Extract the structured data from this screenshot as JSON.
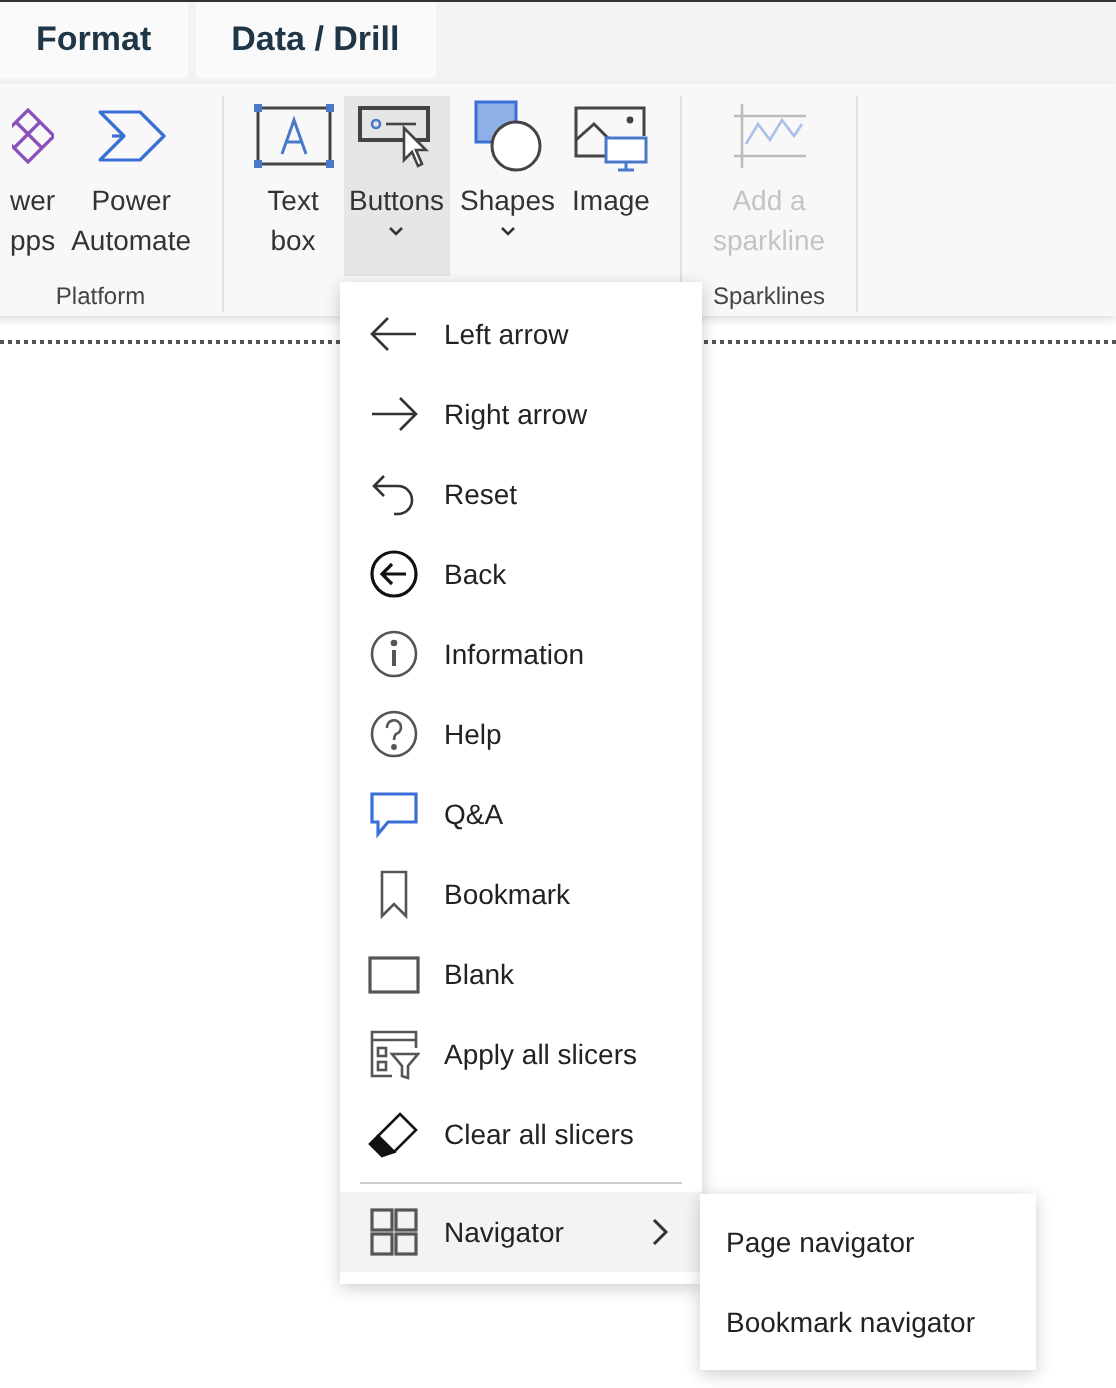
{
  "tabs": [
    {
      "label": "Format",
      "selected": false
    },
    {
      "label": "Data / Drill",
      "selected": false
    }
  ],
  "ribbon": {
    "groups": [
      {
        "label": "Platform",
        "items": [
          {
            "kind": "powerapps",
            "label_lines": [
              "wer",
              "pps"
            ],
            "selected": false,
            "disabled": false,
            "dropdown": false
          },
          {
            "kind": "automate",
            "label_lines": [
              "Power",
              "Automate"
            ],
            "selected": false,
            "disabled": false,
            "dropdown": false
          }
        ]
      },
      {
        "items": [
          {
            "kind": "textbox",
            "label_lines": [
              "Text",
              "box"
            ],
            "selected": false,
            "disabled": false,
            "dropdown": false
          },
          {
            "kind": "buttons",
            "label_lines": [
              "Buttons"
            ],
            "selected": true,
            "disabled": false,
            "dropdown": true
          },
          {
            "kind": "shapes",
            "label_lines": [
              "Shapes"
            ],
            "selected": false,
            "disabled": false,
            "dropdown": true
          },
          {
            "kind": "image",
            "label_lines": [
              "Image"
            ],
            "selected": false,
            "disabled": false,
            "dropdown": false
          }
        ]
      },
      {
        "label": "Sparklines",
        "items": [
          {
            "kind": "sparkline",
            "label_lines": [
              "Add a",
              "sparkline"
            ],
            "selected": false,
            "disabled": true,
            "dropdown": false
          }
        ]
      }
    ]
  },
  "menu": {
    "items": [
      {
        "kind": "left",
        "label": "Left arrow"
      },
      {
        "kind": "right",
        "label": "Right arrow"
      },
      {
        "kind": "reset",
        "label": "Reset"
      },
      {
        "kind": "back",
        "label": "Back"
      },
      {
        "kind": "info",
        "label": "Information"
      },
      {
        "kind": "help",
        "label": "Help"
      },
      {
        "kind": "qa",
        "label": "Q&A"
      },
      {
        "kind": "bookmark",
        "label": "Bookmark"
      },
      {
        "kind": "blank",
        "label": "Blank"
      },
      {
        "kind": "apply",
        "label": "Apply all slicers"
      },
      {
        "kind": "clear",
        "label": "Clear all slicers"
      },
      {
        "kind": "navigator",
        "label": "Navigator",
        "expanded": true
      }
    ]
  },
  "submenu": {
    "items": [
      "Page navigator",
      "Bookmark navigator"
    ]
  }
}
